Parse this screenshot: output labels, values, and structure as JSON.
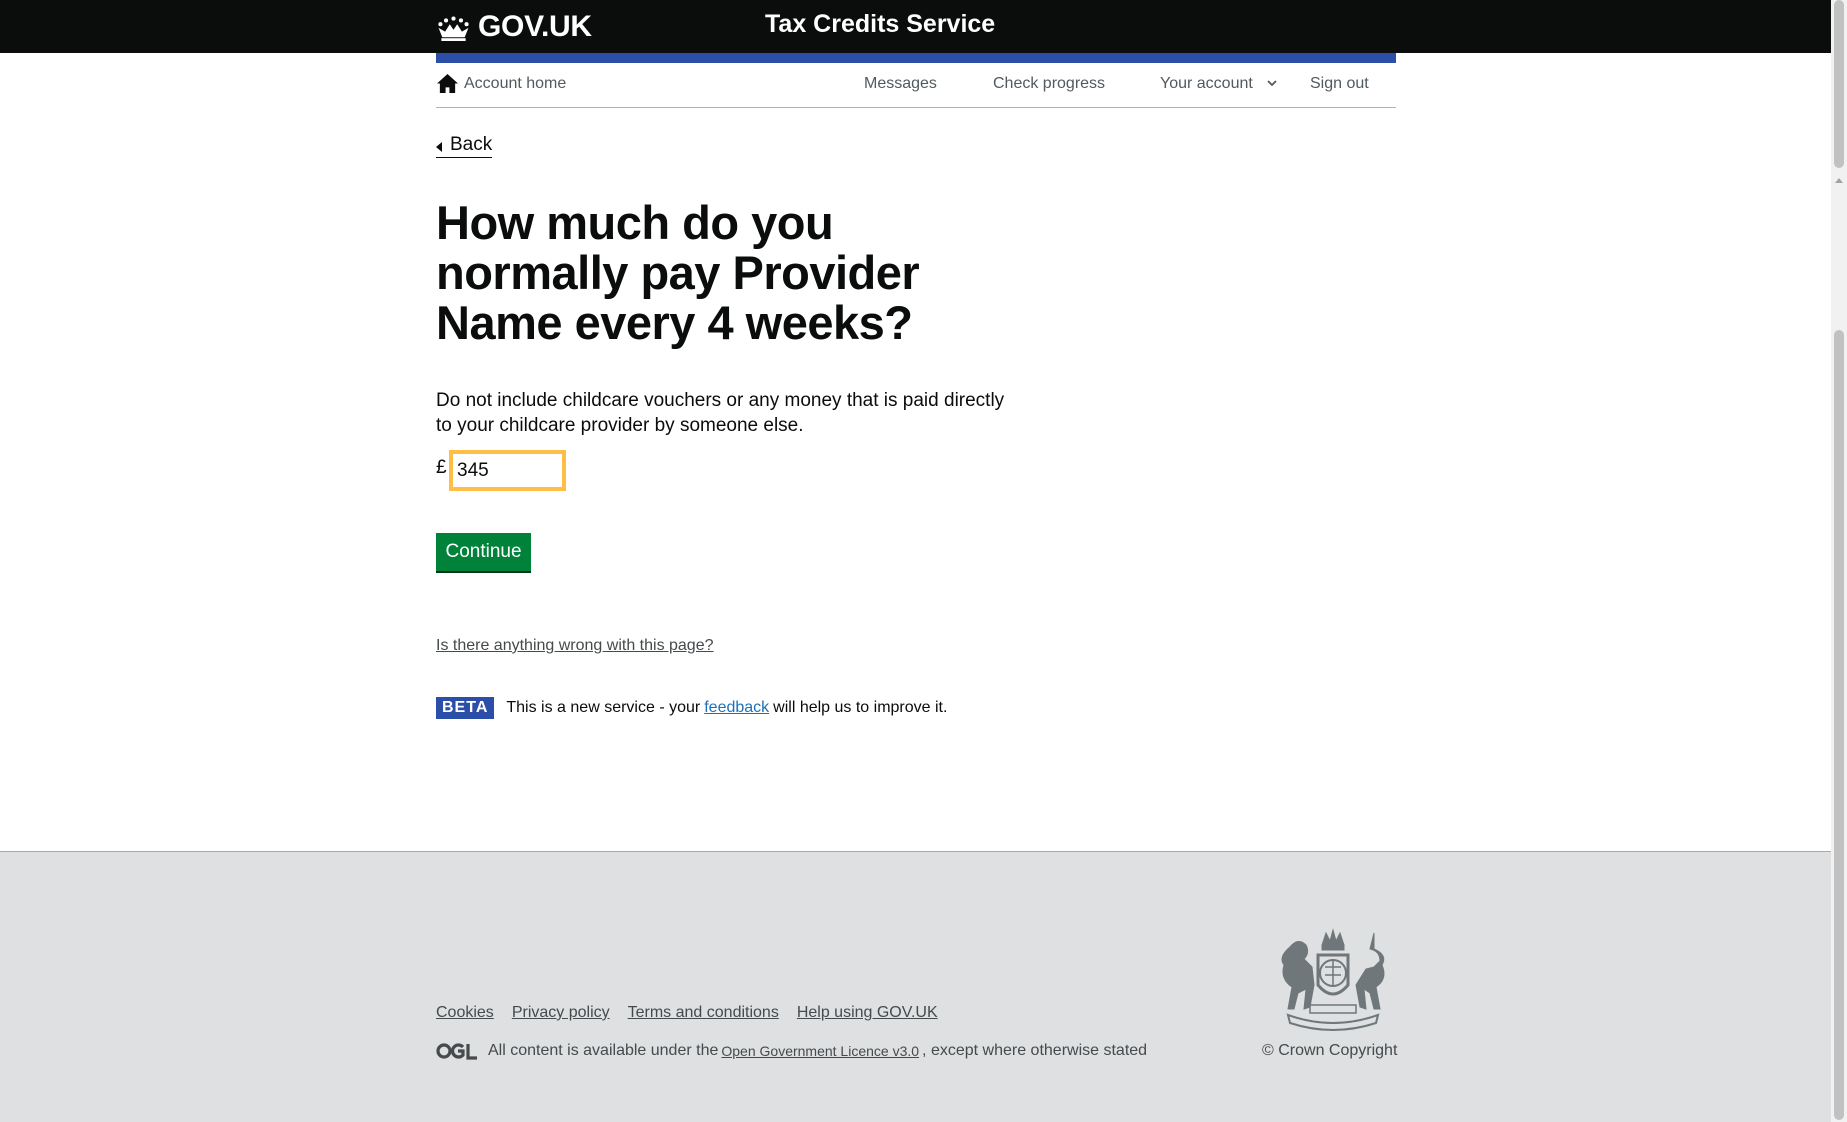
{
  "header": {
    "logo_text": "GOV.UK",
    "service_name": "Tax Credits Service"
  },
  "account_nav": {
    "home": "Account home",
    "messages": "Messages",
    "check_progress": "Check progress",
    "your_account": "Your account",
    "sign_out": "Sign out"
  },
  "back_label": "Back",
  "heading": "How much do you normally pay Provider Name every 4 weeks?",
  "hint": "Do not include childcare vouchers or any money that is paid directly to your childcare provider by someone else.",
  "amount": {
    "currency_symbol": "£",
    "value": "345"
  },
  "continue_label": "Continue",
  "report_link": "Is there anything wrong with this page?",
  "beta_banner": {
    "tag": "BETA",
    "text_before": "This is a new service  - your",
    "link": "feedback",
    "text_after": "will help us to improve it."
  },
  "footer": {
    "links": [
      "Cookies",
      "Privacy policy",
      "Terms and conditions",
      "Help using GOV.UK"
    ],
    "licence_before": "All content is available under the",
    "licence_link": "Open Government Licence v3.0",
    "licence_after": ", except where otherwise stated",
    "copyright": "© Crown Copyright"
  },
  "colors": {
    "header_bg": "#0b0c0c",
    "accent_bar": "#2b4fa8",
    "button_green": "#00823b",
    "focus_yellow": "#ffbf47",
    "footer_bg": "#dee0e2"
  }
}
